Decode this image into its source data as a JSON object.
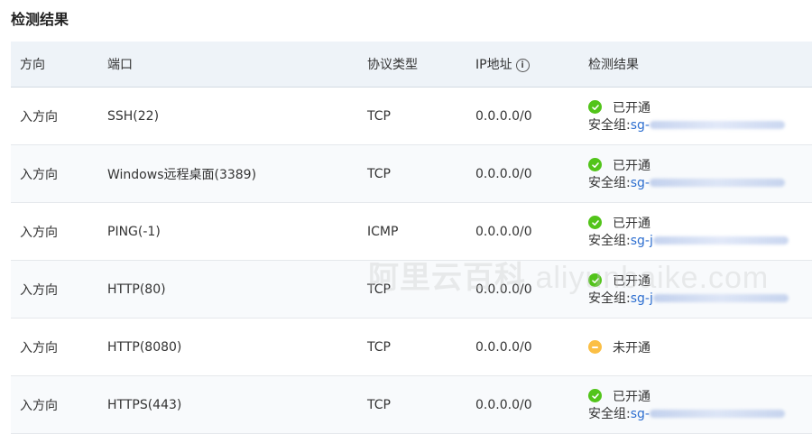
{
  "title": "检测结果",
  "headers": {
    "direction": "方向",
    "port": "端口",
    "protocol": "协议类型",
    "ip": "IP地址",
    "result": "检测结果"
  },
  "rows": [
    {
      "direction": "入方向",
      "port": "SSH(22)",
      "protocol": "TCP",
      "ip": "0.0.0.0/0",
      "status": "已开通",
      "sg_label": "安全组:",
      "sg_prefix": "sg-"
    },
    {
      "direction": "入方向",
      "port": "Windows远程桌面(3389)",
      "protocol": "TCP",
      "ip": "0.0.0.0/0",
      "status": "已开通",
      "sg_label": "安全组:",
      "sg_prefix": "sg-"
    },
    {
      "direction": "入方向",
      "port": "PING(-1)",
      "protocol": "ICMP",
      "ip": "0.0.0.0/0",
      "status": "已开通",
      "sg_label": "安全组:",
      "sg_prefix": "sg-j"
    },
    {
      "direction": "入方向",
      "port": "HTTP(80)",
      "protocol": "TCP",
      "ip": "0.0.0.0/0",
      "status": "已开通",
      "sg_label": "安全组:",
      "sg_prefix": "sg-j"
    },
    {
      "direction": "入方向",
      "port": "HTTP(8080)",
      "protocol": "TCP",
      "ip": "0.0.0.0/0",
      "status": "未开通"
    },
    {
      "direction": "入方向",
      "port": "HTTPS(443)",
      "protocol": "TCP",
      "ip": "0.0.0.0/0",
      "status": "已开通",
      "sg_label": "安全组:",
      "sg_prefix": "sg-"
    }
  ],
  "icons": {
    "ok": "check-circle-icon",
    "pending": "minus-circle-icon",
    "info": "info-icon"
  },
  "colors": {
    "ok": "#52c41a",
    "pending": "#fbbf45",
    "link": "#2e6fd0",
    "header_bg": "#eef3f8"
  },
  "watermark": {
    "cn": "阿里云百科",
    "latin": " aliyunbaike.com"
  }
}
